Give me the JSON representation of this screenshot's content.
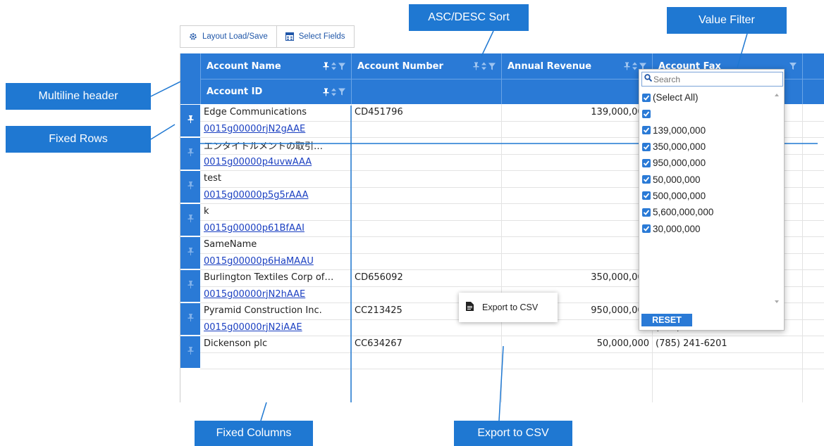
{
  "toolbar": {
    "layout_label": "Layout Load/Save",
    "fields_label": "Select Fields"
  },
  "header": {
    "account_name": "Account Name",
    "account_id": "Account ID",
    "account_number": "Account Number",
    "annual_revenue": "Annual Revenue",
    "account_fax": "Account Fax"
  },
  "rows": [
    {
      "name": "Edge Communications",
      "id": "0015g00000rjN2gAAE",
      "number": "CD451796",
      "revenue": "139,000,000",
      "fax1": "",
      "fax2": "",
      "pinned": true
    },
    {
      "name": "エンタイトルメントの取引…",
      "id": "0015g00000p4uvwAAA",
      "number": "",
      "revenue": "",
      "fax1": "",
      "fax2": "",
      "pinned": false
    },
    {
      "name": "test",
      "id": "0015g00000p5g5rAAA",
      "number": "",
      "revenue": "",
      "fax1": "",
      "fax2": "",
      "pinned": false
    },
    {
      "name": "k",
      "id": "0015g00000p61BfAAI",
      "number": "",
      "revenue": "",
      "fax1": "",
      "fax2": "",
      "pinned": false
    },
    {
      "name": "SameName",
      "id": "0015g00000p6HaMAAU",
      "number": "",
      "revenue": "",
      "fax1": "",
      "fax2": "",
      "pinned": false
    },
    {
      "name": "Burlington Textiles Corp of…",
      "id": "0015g00000rjN2hAAE",
      "number": "CD656092",
      "revenue": "350,000,000",
      "fax1": "",
      "fax2": "(336) 222-7000",
      "pinned": false
    },
    {
      "name": "Pyramid Construction Inc.",
      "id": "0015g00000rjN2iAAE",
      "number": "CC213425",
      "revenue": "950,000,000",
      "fax1": "(014) 427-4428",
      "fax2": "(014) 427-4427",
      "pinned": false
    },
    {
      "name": "Dickenson plc",
      "id": "",
      "number": "CC634267",
      "revenue": "50,000,000",
      "fax1": "(785) 241-6201",
      "fax2": "",
      "pinned": false
    }
  ],
  "filter": {
    "search_placeholder": "Search",
    "options": [
      "(Select All)",
      "",
      "139,000,000",
      "350,000,000",
      "950,000,000",
      "50,000,000",
      "500,000,000",
      "5,600,000,000",
      "30,000,000"
    ],
    "reset_label": "RESET"
  },
  "context_menu": {
    "export_label": "Export to CSV"
  },
  "callouts": {
    "multiline_header": "Multiline header",
    "fixed_rows": "Fixed Rows",
    "asc_desc_sort": "ASC/DESC Sort",
    "value_filter": "Value Filter",
    "fixed_columns": "Fixed Columns",
    "export_to_csv": "Export to CSV"
  },
  "colors": {
    "header_blue": "#2a7ad6",
    "callout_blue": "#1f78d2",
    "link_blue": "#1a3fc1"
  },
  "icons": [
    "gear-icon",
    "fields-icon",
    "pin-icon",
    "sort-icon",
    "filter-icon",
    "search-icon",
    "checkbox-icon",
    "file-icon"
  ]
}
